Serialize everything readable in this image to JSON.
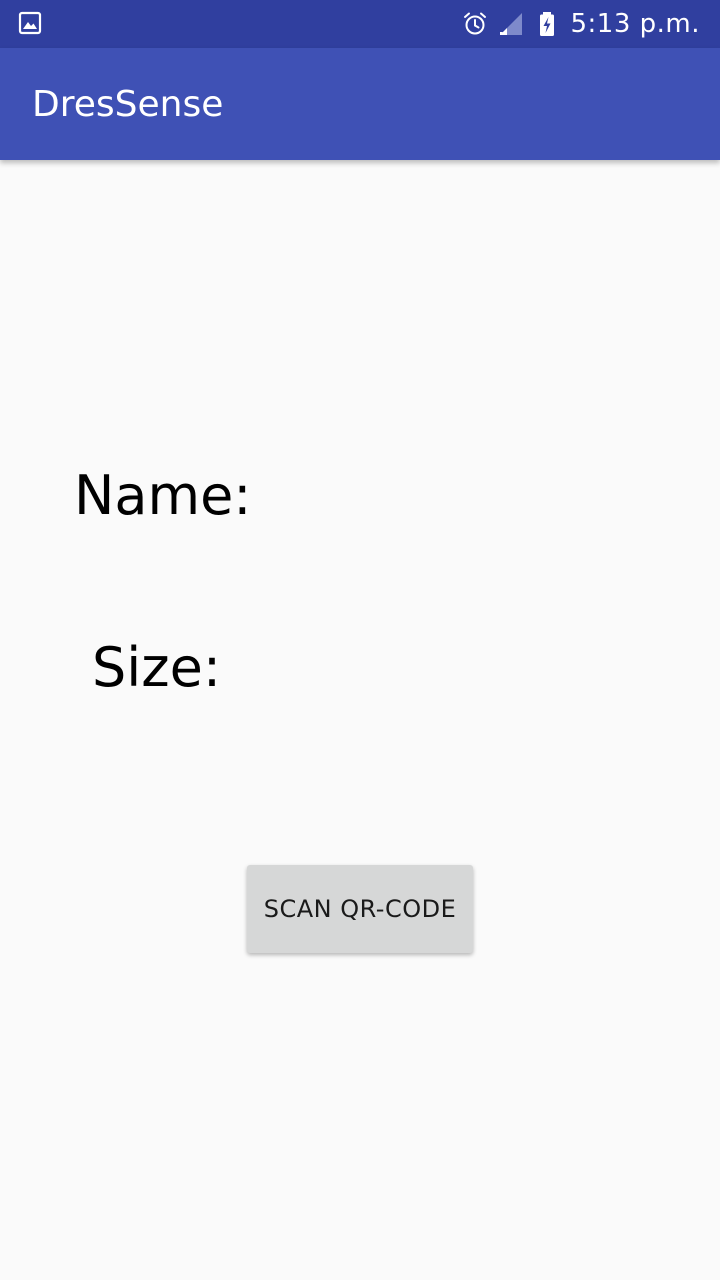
{
  "status_bar": {
    "time": "5:13 p.m.",
    "left_icon": "gallery-notification-icon",
    "icons": [
      "alarm-icon",
      "signal-icon",
      "battery-charging-icon"
    ],
    "background": "#303f9f"
  },
  "app_bar": {
    "title": "DresSense",
    "background": "#3f51b5"
  },
  "main": {
    "name_label": "Name:",
    "size_label": "Size:",
    "scan_button_label": "SCAN QR-CODE",
    "button_color": "#d6d7d7",
    "background": "#fafafa"
  }
}
